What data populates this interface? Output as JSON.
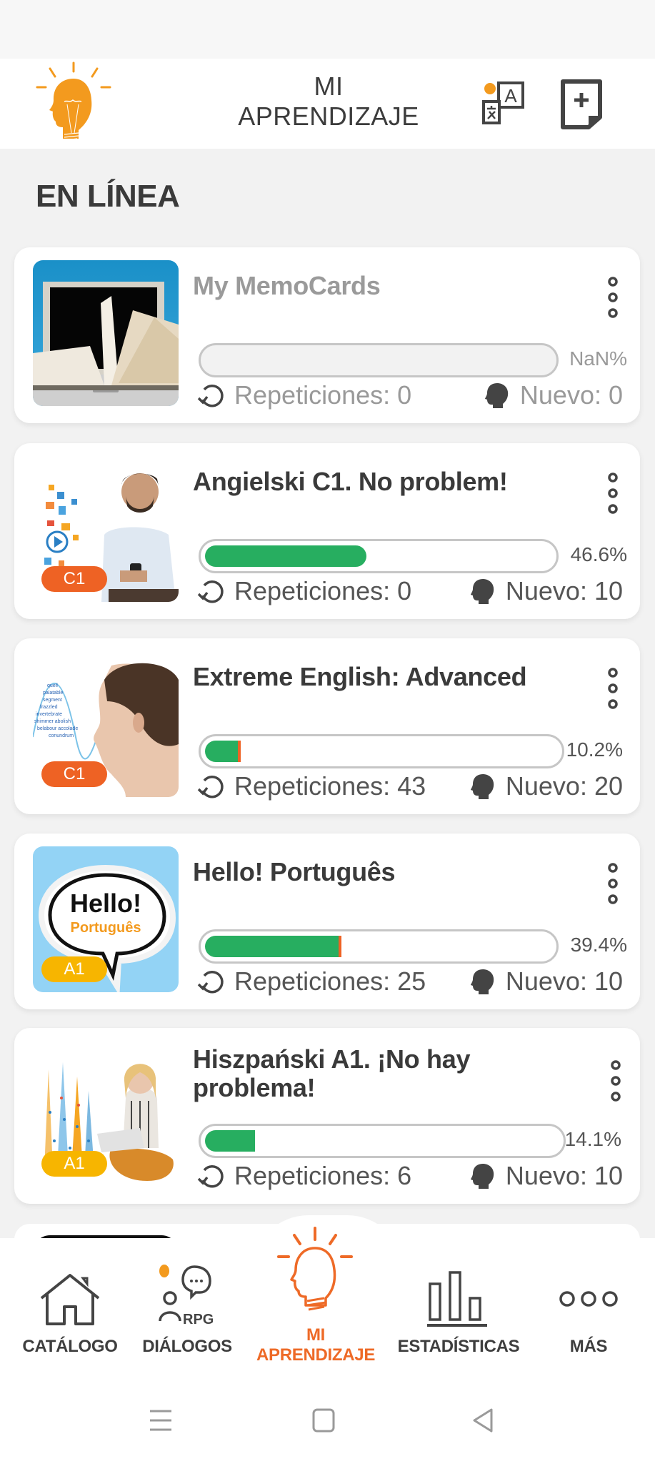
{
  "header": {
    "title_line1": "MI",
    "title_line2": "APRENDIZAJE",
    "logo_icon": "lightbulb-head-icon",
    "translate_icon": "translate-icon",
    "add_icon": "add-document-icon"
  },
  "section_title": "EN LÍNEA",
  "courses": [
    {
      "title": "My MemoCards",
      "progress_label": "NaN%",
      "progress": null,
      "repetitions_label": "Repeticiones: 0",
      "new_label": "Nuevo: 0",
      "badge": "",
      "muted": true
    },
    {
      "title": "Angielski C1. No problem!",
      "progress_label": "46.6%",
      "progress": 46.6,
      "repetitions_label": "Repeticiones: 0",
      "new_label": "Nuevo: 10",
      "badge": "C1",
      "muted": false
    },
    {
      "title": "Extreme English: Advanced",
      "progress_label": "10.2%",
      "progress": 10.2,
      "repetitions_label": "Repeticiones: 43",
      "new_label": "Nuevo: 20",
      "badge": "C1",
      "muted": false
    },
    {
      "title": "Hello! Português",
      "progress_label": "39.4%",
      "progress": 39.4,
      "repetitions_label": "Repeticiones: 25",
      "new_label": "Nuevo: 10",
      "badge": "A1",
      "muted": false
    },
    {
      "title": "Hiszpański A1. ¡No hay problema!",
      "progress_label": "14.1%",
      "progress": 14.1,
      "repetitions_label": "Repeticiones: 6",
      "new_label": "Nuevo: 10",
      "badge": "A1",
      "muted": false
    }
  ],
  "thumb_texts": {
    "hello_main": "Hello!",
    "hello_sub": "Português"
  },
  "bottom_nav": [
    {
      "label": "CATÁLOGO",
      "icon": "home-icon",
      "active": false
    },
    {
      "label": "DIÁLOGOS",
      "icon": "dialogs-rpg-icon",
      "active": false,
      "sub": "RPG"
    },
    {
      "label_line1": "MI",
      "label_line2": "APRENDIZAJE",
      "icon": "lightbulb-head-icon",
      "active": true
    },
    {
      "label": "ESTADÍSTICAS",
      "icon": "bar-chart-icon",
      "active": false
    },
    {
      "label": "MÁS",
      "icon": "more-icon",
      "active": false
    }
  ],
  "colors": {
    "accent": "#ee6a27",
    "logo_orange": "#f39a1e",
    "progress_green": "#27ae60",
    "badge_c1": "#ee6224",
    "badge_a1": "#f7b500",
    "text_dark": "#3a3a3a"
  }
}
